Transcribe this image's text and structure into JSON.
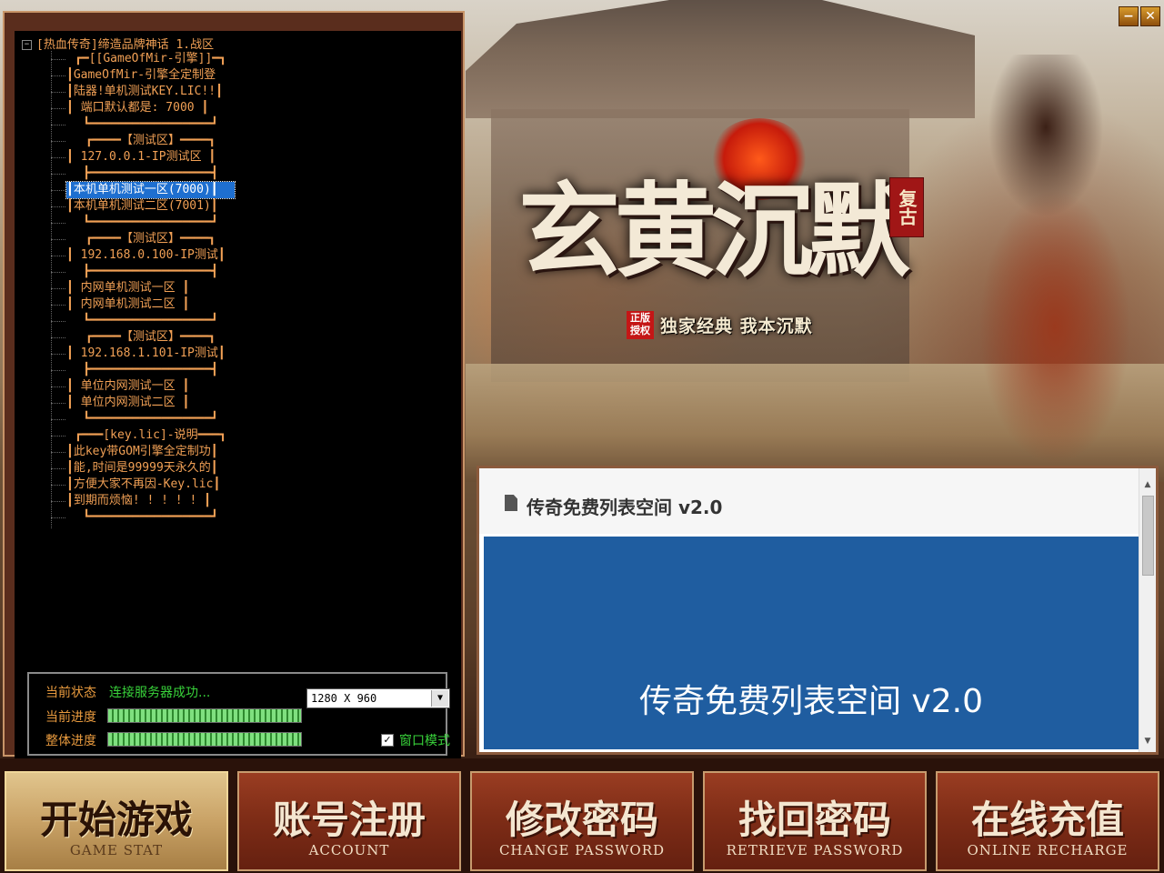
{
  "window": {
    "minimize_label": "−",
    "close_label": "✕"
  },
  "banner": {
    "title": "玄黄沉默",
    "badge": "复古",
    "auth_badge": "正版授权",
    "slogan": "独家经典  我本沉默"
  },
  "server_tree": {
    "root": "[热血传奇]缔造品牌神话 1.战区",
    "nodes": [
      {
        "kind": "hdr",
        "text": "┏━[[GameOfMir-引擎]]━┓"
      },
      {
        "kind": "text",
        "text": "┃GameOfMir-引擎全定制登"
      },
      {
        "kind": "text",
        "text": "┃陆器!单机测试KEY.LIC!!┃"
      },
      {
        "kind": "text",
        "text": "┃ 端口默认都是: 7000  ┃"
      },
      {
        "kind": "hdr",
        "text": "┗━━━━━━━━━━━━━━━━━┛"
      },
      {
        "kind": "hdr",
        "text": "┏━━━━【测试区】━━━━┓"
      },
      {
        "kind": "text",
        "text": "┃ 127.0.0.1-IP测试区 ┃"
      },
      {
        "kind": "hdr",
        "text": "┣━━━━━━━━━━━━━━━━━┫"
      },
      {
        "kind": "sel",
        "text": "┃本机单机测试一区(7000)┃"
      },
      {
        "kind": "text",
        "text": "┃本机单机测试二区(7001)┃"
      },
      {
        "kind": "hdr",
        "text": "┗━━━━━━━━━━━━━━━━━┛"
      },
      {
        "kind": "hdr",
        "text": "┏━━━━【测试区】━━━━┓"
      },
      {
        "kind": "text",
        "text": "┃ 192.168.0.100-IP测试┃"
      },
      {
        "kind": "hdr",
        "text": "┣━━━━━━━━━━━━━━━━━┫"
      },
      {
        "kind": "text",
        "text": "┃    内网单机测试一区  ┃"
      },
      {
        "kind": "text",
        "text": "┃    内网单机测试二区  ┃"
      },
      {
        "kind": "hdr",
        "text": "┗━━━━━━━━━━━━━━━━━┛"
      },
      {
        "kind": "hdr",
        "text": "┏━━━━【测试区】━━━━┓"
      },
      {
        "kind": "text",
        "text": "┃ 192.168.1.101-IP测试┃"
      },
      {
        "kind": "hdr",
        "text": "┣━━━━━━━━━━━━━━━━━┫"
      },
      {
        "kind": "text",
        "text": "┃    单位内网测试一区  ┃"
      },
      {
        "kind": "text",
        "text": "┃    单位内网测试二区  ┃"
      },
      {
        "kind": "hdr",
        "text": "┗━━━━━━━━━━━━━━━━━┛"
      },
      {
        "kind": "hdr",
        "text": "┏━━━[key.lic]-说明━━━┓"
      },
      {
        "kind": "text",
        "text": "┃此key带GOM引擎全定制功┃"
      },
      {
        "kind": "text",
        "text": "┃能,时间是99999天永久的┃"
      },
      {
        "kind": "text",
        "text": "┃方便大家不再因-Key.lic┃"
      },
      {
        "kind": "text",
        "text": "┃到期而烦恼! ! ! ! ! ┃"
      },
      {
        "kind": "hdr",
        "text": "┗━━━━━━━━━━━━━━━━━┛"
      }
    ]
  },
  "status": {
    "state_label": "当前状态",
    "state_value": "连接服务器成功...",
    "current_progress_label": "当前进度",
    "current_progress": 1.0,
    "overall_progress_label": "整体进度",
    "overall_progress": 1.0,
    "resolution": "1280 X 960",
    "window_mode_label": "窗口模式",
    "window_mode_checked": true
  },
  "notice": {
    "header_title": "传奇免费列表空间 v2.0",
    "body_text": "传奇免费列表空间 v2.0"
  },
  "buttons": [
    {
      "cn": "开始游戏",
      "en": "GAME STAT",
      "active": true
    },
    {
      "cn": "账号注册",
      "en": "ACCOUNT",
      "active": false
    },
    {
      "cn": "修改密码",
      "en": "CHANGE PASSWORD",
      "active": false
    },
    {
      "cn": "找回密码",
      "en": "RETRIEVE PASSWORD",
      "active": false
    },
    {
      "cn": "在线充值",
      "en": "ONLINE RECHARGE",
      "active": false
    }
  ]
}
